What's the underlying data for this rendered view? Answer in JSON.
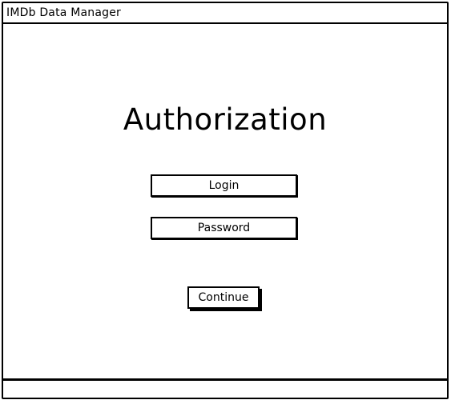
{
  "window": {
    "title": "IMDb Data Manager"
  },
  "auth": {
    "heading": "Authorization",
    "login_placeholder": "Login",
    "password_placeholder": "Password",
    "continue_label": "Continue"
  }
}
